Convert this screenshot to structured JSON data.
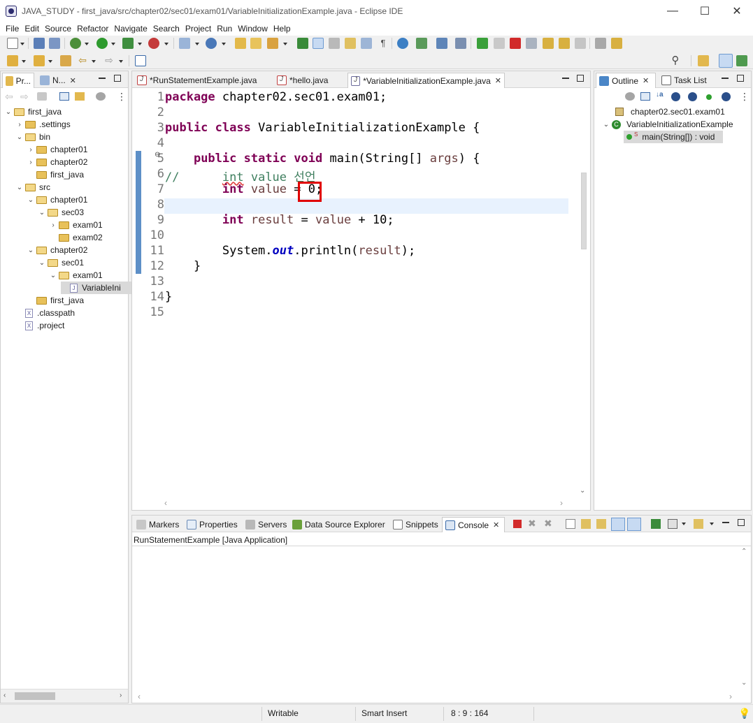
{
  "window": {
    "title": "JAVA_STUDY - first_java/src/chapter02/sec01/exam01/VariableInitializationExample.java - Eclipse IDE",
    "minimize": "—",
    "maximize": "☐",
    "close": "✕"
  },
  "menu": [
    "File",
    "Edit",
    "Source",
    "Refactor",
    "Navigate",
    "Search",
    "Project",
    "Run",
    "Window",
    "Help"
  ],
  "left_panel": {
    "tabs": [
      "Pr...",
      "N..."
    ],
    "tree": [
      {
        "label": "first_java",
        "depth": 0,
        "expanded": true,
        "icon": "project-icon"
      },
      {
        "label": ".settings",
        "depth": 1,
        "expanded": false,
        "icon": "folder-icon"
      },
      {
        "label": "bin",
        "depth": 1,
        "expanded": true,
        "icon": "folder-icon"
      },
      {
        "label": "chapter01",
        "depth": 2,
        "expanded": false,
        "icon": "folder-icon"
      },
      {
        "label": "chapter02",
        "depth": 2,
        "expanded": false,
        "icon": "folder-icon"
      },
      {
        "label": "first_java",
        "depth": 2,
        "expanded": null,
        "icon": "folder-icon"
      },
      {
        "label": "src",
        "depth": 1,
        "expanded": true,
        "icon": "folder-icon"
      },
      {
        "label": "chapter01",
        "depth": 2,
        "expanded": true,
        "icon": "folder-icon"
      },
      {
        "label": "sec03",
        "depth": 3,
        "expanded": true,
        "icon": "folder-icon"
      },
      {
        "label": "exam01",
        "depth": 4,
        "expanded": false,
        "icon": "folder-icon"
      },
      {
        "label": "exam02",
        "depth": 4,
        "expanded": null,
        "icon": "folder-icon"
      },
      {
        "label": "chapter02",
        "depth": 2,
        "expanded": true,
        "icon": "folder-icon"
      },
      {
        "label": "sec01",
        "depth": 3,
        "expanded": true,
        "icon": "folder-icon"
      },
      {
        "label": "exam01",
        "depth": 4,
        "expanded": true,
        "icon": "folder-icon"
      },
      {
        "label": "VariableIni",
        "depth": 5,
        "expanded": null,
        "icon": "java-file-icon",
        "selected": true
      },
      {
        "label": "first_java",
        "depth": 2,
        "expanded": null,
        "icon": "folder-icon"
      },
      {
        "label": ".classpath",
        "depth": 1,
        "expanded": null,
        "icon": "xml-file-icon"
      },
      {
        "label": ".project",
        "depth": 1,
        "expanded": null,
        "icon": "xml-file-icon"
      }
    ]
  },
  "editor": {
    "tabs": [
      {
        "label": "*RunStatementExample.java",
        "active": false
      },
      {
        "label": "*hello.java",
        "active": false
      },
      {
        "label": "*VariableInitializationExample.java",
        "active": true
      }
    ],
    "line_numbers": [
      "1",
      "2",
      "3",
      "4",
      "5",
      "6",
      "7",
      "8",
      "9",
      "10",
      "11",
      "12",
      "13",
      "14",
      "15"
    ],
    "current_line": 8,
    "highlight_box": "0;"
  },
  "outline": {
    "tabs": [
      "Outline",
      "Task List"
    ],
    "items": [
      {
        "label": "chapter02.sec01.exam01",
        "depth": 0
      },
      {
        "label": "VariableInitializationExample",
        "depth": 0
      },
      {
        "label": "main(String[]) : void",
        "depth": 1
      }
    ]
  },
  "bottom_panel": {
    "tabs": [
      "Markers",
      "Properties",
      "Servers",
      "Data Source Explorer",
      "Snippets",
      "Console"
    ],
    "console_title": "RunStatementExample [Java Application]"
  },
  "statusbar": {
    "writable": "Writable",
    "insert_mode": "Smart Insert",
    "position": "8 : 9 : 164"
  }
}
